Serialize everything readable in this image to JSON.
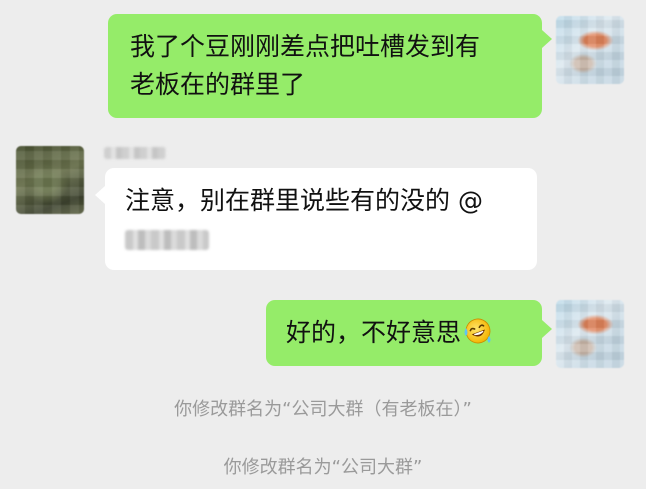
{
  "messages": [
    {
      "sender": "self",
      "text_line1": "我了个豆刚刚差点把吐槽发到有",
      "text_line2": "老板在的群里了"
    },
    {
      "sender": "other",
      "text": "注意，别在群里说些有的没的 @"
    },
    {
      "sender": "self",
      "text": "好的，不好意思"
    }
  ],
  "system_notices": [
    "你修改群名为“公司大群（有老板在）”",
    "你修改群名为“公司大群”"
  ],
  "icons": {
    "reaction_emoji": "laughing-crying-emoji-icon"
  },
  "colors": {
    "background": "#ededed",
    "self_bubble": "#95ec69",
    "other_bubble": "#ffffff",
    "system_text": "#9a9a9a"
  }
}
